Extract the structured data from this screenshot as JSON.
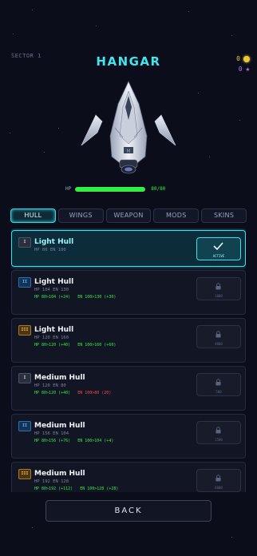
{
  "header": {
    "sector": "SECTOR 1",
    "title": "HANGAR",
    "coins": "0",
    "stars": "0"
  },
  "ship": {
    "hp_label": "HP",
    "hp_value": "80/80",
    "hp_fraction": 1.0
  },
  "tabs": [
    {
      "label": "HULL",
      "active": true
    },
    {
      "label": "WINGS",
      "active": false
    },
    {
      "label": "WEAPON",
      "active": false
    },
    {
      "label": "MODS",
      "active": false
    },
    {
      "label": "SKINS",
      "active": false
    }
  ],
  "items": [
    {
      "tier": "I",
      "name": "Light Hull",
      "stats": "HP 80   EN 100",
      "delta_hp": "",
      "delta_en": "",
      "action": "ACTIVE"
    },
    {
      "tier": "II",
      "name": "Light Hull",
      "stats": "HP 104   EN 130",
      "delta_hp": "HP 80>104 (+24)",
      "delta_en": "EN 100>130 (+30)",
      "action": "1000"
    },
    {
      "tier": "III",
      "name": "Light Hull",
      "stats": "HP 120   EN 160",
      "delta_hp": "HP 80>120 (+40)",
      "delta_en": "EN 100>160 (+60)",
      "action": "4000"
    },
    {
      "tier": "I",
      "name": "Medium Hull",
      "stats": "HP 120   EN 80",
      "delta_hp": "HP 80>120 (+40)",
      "delta_en": "EN 100>80 (20)",
      "action": "500"
    },
    {
      "tier": "II",
      "name": "Medium Hull",
      "stats": "HP 156   EN 104",
      "delta_hp": "HP 80>156 (+76)",
      "delta_en": "EN 100>104 (+4)",
      "action": "1500"
    },
    {
      "tier": "III",
      "name": "Medium Hull",
      "stats": "HP 192   EN 128",
      "delta_hp": "HP 80>192 (+112)",
      "delta_en": "EN 100>128 (+28)",
      "action": "6000"
    }
  ],
  "footer": {
    "back_label": "BACK"
  },
  "colors": {
    "accent": "#35e3ee",
    "hp": "#33ef44",
    "gain": "#33ef44",
    "loss": "#ff4646",
    "coin": "#e7c93a",
    "star": "#b07af0"
  },
  "icons": {
    "coin": "coin-icon",
    "star": "star-icon",
    "lock": "lock-icon",
    "check": "check-icon"
  }
}
